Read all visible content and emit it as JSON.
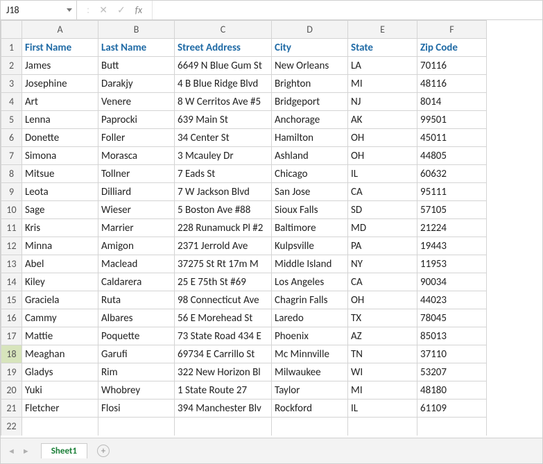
{
  "formula_bar": {
    "name_box": "J18",
    "fx_label": "fx",
    "divider": ":",
    "cancel_glyph": "✕",
    "accept_glyph": "✓"
  },
  "columns": [
    "A",
    "B",
    "C",
    "D",
    "E",
    "F"
  ],
  "headers": [
    "First Name",
    "Last Name",
    "Street Address",
    "City",
    "State",
    "Zip Code"
  ],
  "rows": [
    {
      "n": "2",
      "c": [
        "James",
        "Butt",
        "6649 N Blue Gum St",
        "New Orleans",
        "LA",
        "70116"
      ]
    },
    {
      "n": "3",
      "c": [
        "Josephine",
        "Darakjy",
        "4 B Blue Ridge Blvd",
        "Brighton",
        "MI",
        "48116"
      ]
    },
    {
      "n": "4",
      "c": [
        "Art",
        "Venere",
        "8 W Cerritos Ave #5",
        "Bridgeport",
        "NJ",
        "8014"
      ]
    },
    {
      "n": "5",
      "c": [
        "Lenna",
        "Paprocki",
        "639 Main St",
        "Anchorage",
        "AK",
        "99501"
      ]
    },
    {
      "n": "6",
      "c": [
        "Donette",
        "Foller",
        "34 Center St",
        "Hamilton",
        "OH",
        "45011"
      ]
    },
    {
      "n": "7",
      "c": [
        "Simona",
        "Morasca",
        "3 Mcauley Dr",
        "Ashland",
        "OH",
        "44805"
      ]
    },
    {
      "n": "8",
      "c": [
        "Mitsue",
        "Tollner",
        "7 Eads St",
        "Chicago",
        "IL",
        "60632"
      ]
    },
    {
      "n": "9",
      "c": [
        "Leota",
        "Dilliard",
        "7 W Jackson Blvd",
        "San Jose",
        "CA",
        "95111"
      ]
    },
    {
      "n": "10",
      "c": [
        "Sage",
        "Wieser",
        "5 Boston Ave #88",
        "Sioux Falls",
        "SD",
        "57105"
      ]
    },
    {
      "n": "11",
      "c": [
        "Kris",
        "Marrier",
        "228 Runamuck Pl #2",
        "Baltimore",
        "MD",
        "21224"
      ]
    },
    {
      "n": "12",
      "c": [
        "Minna",
        "Amigon",
        "2371 Jerrold Ave",
        "Kulpsville",
        "PA",
        "19443"
      ]
    },
    {
      "n": "13",
      "c": [
        "Abel",
        "Maclead",
        "37275 St  Rt 17m M",
        "Middle Island",
        "NY",
        "11953"
      ]
    },
    {
      "n": "14",
      "c": [
        "Kiley",
        "Caldarera",
        "25 E 75th St #69",
        "Los Angeles",
        "CA",
        "90034"
      ]
    },
    {
      "n": "15",
      "c": [
        "Graciela",
        "Ruta",
        "98 Connecticut Ave",
        "Chagrin Falls",
        "OH",
        "44023"
      ]
    },
    {
      "n": "16",
      "c": [
        "Cammy",
        "Albares",
        "56 E Morehead St",
        "Laredo",
        "TX",
        "78045"
      ]
    },
    {
      "n": "17",
      "c": [
        "Mattie",
        "Poquette",
        "73 State Road 434 E",
        "Phoenix",
        "AZ",
        "85013"
      ]
    },
    {
      "n": "18",
      "c": [
        "Meaghan",
        "Garufi",
        "69734 E Carrillo St",
        "Mc Minnville",
        "TN",
        "37110"
      ]
    },
    {
      "n": "19",
      "c": [
        "Gladys",
        "Rim",
        "322 New Horizon Bl",
        "Milwaukee",
        "WI",
        "53207"
      ]
    },
    {
      "n": "20",
      "c": [
        "Yuki",
        "Whobrey",
        "1 State Route 27",
        "Taylor",
        "MI",
        "48180"
      ]
    },
    {
      "n": "21",
      "c": [
        "Fletcher",
        "Flosi",
        "394 Manchester Blv",
        "Rockford",
        "IL",
        "61109"
      ]
    }
  ],
  "empty_row": "22",
  "active_row": "18",
  "tabs": {
    "sheet": "Sheet1",
    "add": "+",
    "nav_left": "◄",
    "nav_right": "►"
  }
}
